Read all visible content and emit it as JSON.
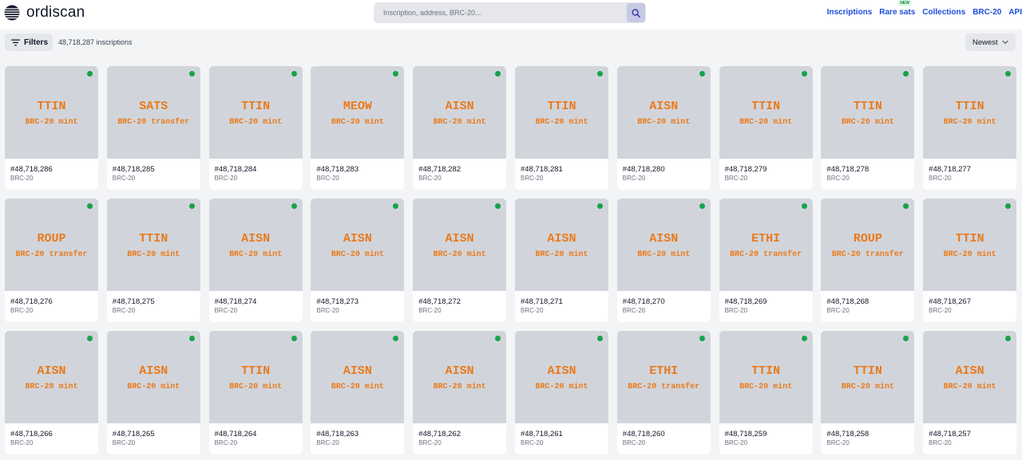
{
  "header": {
    "brand": "ordiscan",
    "search_placeholder": "Inscription, address, BRC-20...",
    "nav": [
      {
        "label": "Inscriptions",
        "name": "nav-inscriptions"
      },
      {
        "label": "Rare sats",
        "name": "nav-rare-sats",
        "badge": "NEW"
      },
      {
        "label": "Collections",
        "name": "nav-collections"
      },
      {
        "label": "BRC-20",
        "name": "nav-brc20"
      },
      {
        "label": "API",
        "name": "nav-api"
      }
    ]
  },
  "toolbar": {
    "filters_label": "Filters",
    "count": "48,718,287 inscriptions",
    "sort_label": "Newest"
  },
  "icons": {
    "logo": "ordiscan-logo-icon",
    "search": "search-icon",
    "filters": "filters-icon",
    "sort": "chevron-down-icon"
  },
  "colors": {
    "accent": "#1d4ed8",
    "tick_text": "#ea7a1c",
    "status_dot": "#16a34a",
    "thumb_bg": "#d1d5db"
  },
  "inscriptions": [
    {
      "tick": "TTIN",
      "op": "BRC-20 mint",
      "number": "#48,718,286",
      "type": "BRC-20"
    },
    {
      "tick": "SATS",
      "op": "BRC-20 transfer",
      "number": "#48,718,285",
      "type": "BRC-20"
    },
    {
      "tick": "TTIN",
      "op": "BRC-20 mint",
      "number": "#48,718,284",
      "type": "BRC-20"
    },
    {
      "tick": "MEOW",
      "op": "BRC-20 mint",
      "number": "#48,718,283",
      "type": "BRC-20"
    },
    {
      "tick": "AISN",
      "op": "BRC-20 mint",
      "number": "#48,718,282",
      "type": "BRC-20"
    },
    {
      "tick": "TTIN",
      "op": "BRC-20 mint",
      "number": "#48,718,281",
      "type": "BRC-20"
    },
    {
      "tick": "AISN",
      "op": "BRC-20 mint",
      "number": "#48,718,280",
      "type": "BRC-20"
    },
    {
      "tick": "TTIN",
      "op": "BRC-20 mint",
      "number": "#48,718,279",
      "type": "BRC-20"
    },
    {
      "tick": "TTIN",
      "op": "BRC-20 mint",
      "number": "#48,718,278",
      "type": "BRC-20"
    },
    {
      "tick": "TTIN",
      "op": "BRC-20 mint",
      "number": "#48,718,277",
      "type": "BRC-20"
    },
    {
      "tick": "ROUP",
      "op": "BRC-20 transfer",
      "number": "#48,718,276",
      "type": "BRC-20"
    },
    {
      "tick": "TTIN",
      "op": "BRC-20 mint",
      "number": "#48,718,275",
      "type": "BRC-20"
    },
    {
      "tick": "AISN",
      "op": "BRC-20 mint",
      "number": "#48,718,274",
      "type": "BRC-20"
    },
    {
      "tick": "AISN",
      "op": "BRC-20 mint",
      "number": "#48,718,273",
      "type": "BRC-20"
    },
    {
      "tick": "AISN",
      "op": "BRC-20 mint",
      "number": "#48,718,272",
      "type": "BRC-20"
    },
    {
      "tick": "AISN",
      "op": "BRC-20 mint",
      "number": "#48,718,271",
      "type": "BRC-20"
    },
    {
      "tick": "AISN",
      "op": "BRC-20 mint",
      "number": "#48,718,270",
      "type": "BRC-20"
    },
    {
      "tick": "ETHI",
      "op": "BRC-20 transfer",
      "number": "#48,718,269",
      "type": "BRC-20"
    },
    {
      "tick": "ROUP",
      "op": "BRC-20 transfer",
      "number": "#48,718,268",
      "type": "BRC-20"
    },
    {
      "tick": "TTIN",
      "op": "BRC-20 mint",
      "number": "#48,718,267",
      "type": "BRC-20"
    },
    {
      "tick": "AISN",
      "op": "BRC-20 mint",
      "number": "#48,718,266",
      "type": "BRC-20"
    },
    {
      "tick": "AISN",
      "op": "BRC-20 mint",
      "number": "#48,718,265",
      "type": "BRC-20"
    },
    {
      "tick": "TTIN",
      "op": "BRC-20 mint",
      "number": "#48,718,264",
      "type": "BRC-20"
    },
    {
      "tick": "AISN",
      "op": "BRC-20 mint",
      "number": "#48,718,263",
      "type": "BRC-20"
    },
    {
      "tick": "AISN",
      "op": "BRC-20 mint",
      "number": "#48,718,262",
      "type": "BRC-20"
    },
    {
      "tick": "AISN",
      "op": "BRC-20 mint",
      "number": "#48,718,261",
      "type": "BRC-20"
    },
    {
      "tick": "ETHI",
      "op": "BRC-20 transfer",
      "number": "#48,718,260",
      "type": "BRC-20"
    },
    {
      "tick": "TTIN",
      "op": "BRC-20 mint",
      "number": "#48,718,259",
      "type": "BRC-20"
    },
    {
      "tick": "TTIN",
      "op": "BRC-20 mint",
      "number": "#48,718,258",
      "type": "BRC-20"
    },
    {
      "tick": "AISN",
      "op": "BRC-20 mint",
      "number": "#48,718,257",
      "type": "BRC-20"
    }
  ]
}
